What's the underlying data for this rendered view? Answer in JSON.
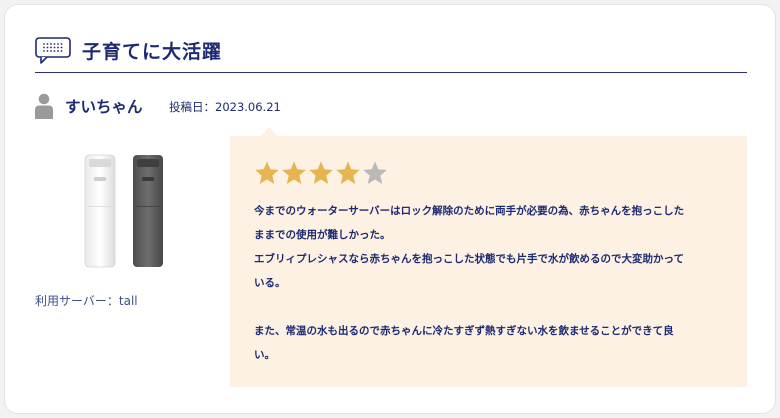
{
  "header": {
    "title": "子育てに大活躍",
    "icon": "chat-bubble-icon"
  },
  "author": {
    "name": "すいちゃん",
    "date_label": "投稿日：2023.06.21",
    "icon": "person-icon"
  },
  "product": {
    "usage_label": "利用サーバー：tall"
  },
  "review": {
    "rating": 4,
    "max_rating": 5,
    "lines": [
      "今までのウォーターサーバーはロック解除のために両手が必要の為、赤ちゃんを抱っこした",
      "ままでの使用が難しかった。",
      "エブリィプレシャスなら赤ちゃんを抱っこした状態でも片手で水が飲めるので大変助かって",
      "いる。",
      "また、常温の水も出るので赤ちゃんに冷たすぎず熱すぎない水を飲ませることができて良",
      "い。"
    ]
  },
  "colors": {
    "accent": "#1d2a72",
    "star_filled": "#e6b552",
    "star_empty": "#b9b9b9",
    "bubble_bg": "#fcf1e2"
  }
}
